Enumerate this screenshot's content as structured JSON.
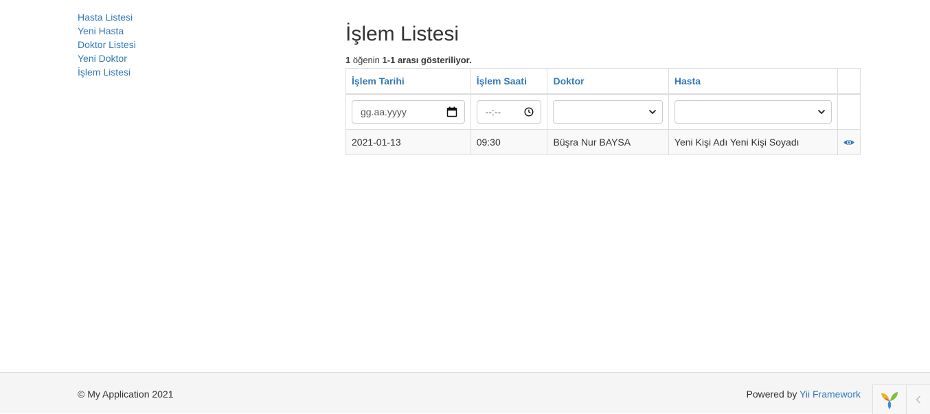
{
  "sidebar": {
    "items": [
      {
        "label": "Hasta Listesi"
      },
      {
        "label": "Yeni Hasta"
      },
      {
        "label": "Doktor Listesi"
      },
      {
        "label": "Yeni Doktor"
      },
      {
        "label": "İşlem Listesi"
      }
    ]
  },
  "page": {
    "title": "İşlem Listesi",
    "summary": {
      "total": "1",
      "of_label": "öğenin",
      "range": "1-1",
      "suffix": "arası gösteriliyor."
    }
  },
  "grid": {
    "columns": [
      "İşlem Tarihi",
      "İşlem Saati",
      "Doktor",
      "Hasta"
    ],
    "filters": {
      "date_placeholder": "gg.aa.yyyy",
      "time_placeholder": "--:--",
      "doctor_selected": "",
      "patient_selected": ""
    },
    "rows": [
      {
        "date": "2021-01-13",
        "time": "09:30",
        "doctor": "Büşra Nur BAYSA",
        "patient": "Yeni Kişi Adı Yeni Kişi Soyadı",
        "action_icon": "eye-icon"
      }
    ]
  },
  "footer": {
    "copyright": "© My Application 2021",
    "powered_prefix": "Powered by",
    "powered_link": "Yii Framework",
    "debug_toggle_icon": "yii-logo-icon",
    "collapse_icon": "chevron-left-icon"
  },
  "colors": {
    "link": "#337ab7",
    "text": "#333333",
    "border": "#dddddd",
    "footer_bg": "#f5f5f5",
    "striped_row": "#f9f9f9"
  }
}
